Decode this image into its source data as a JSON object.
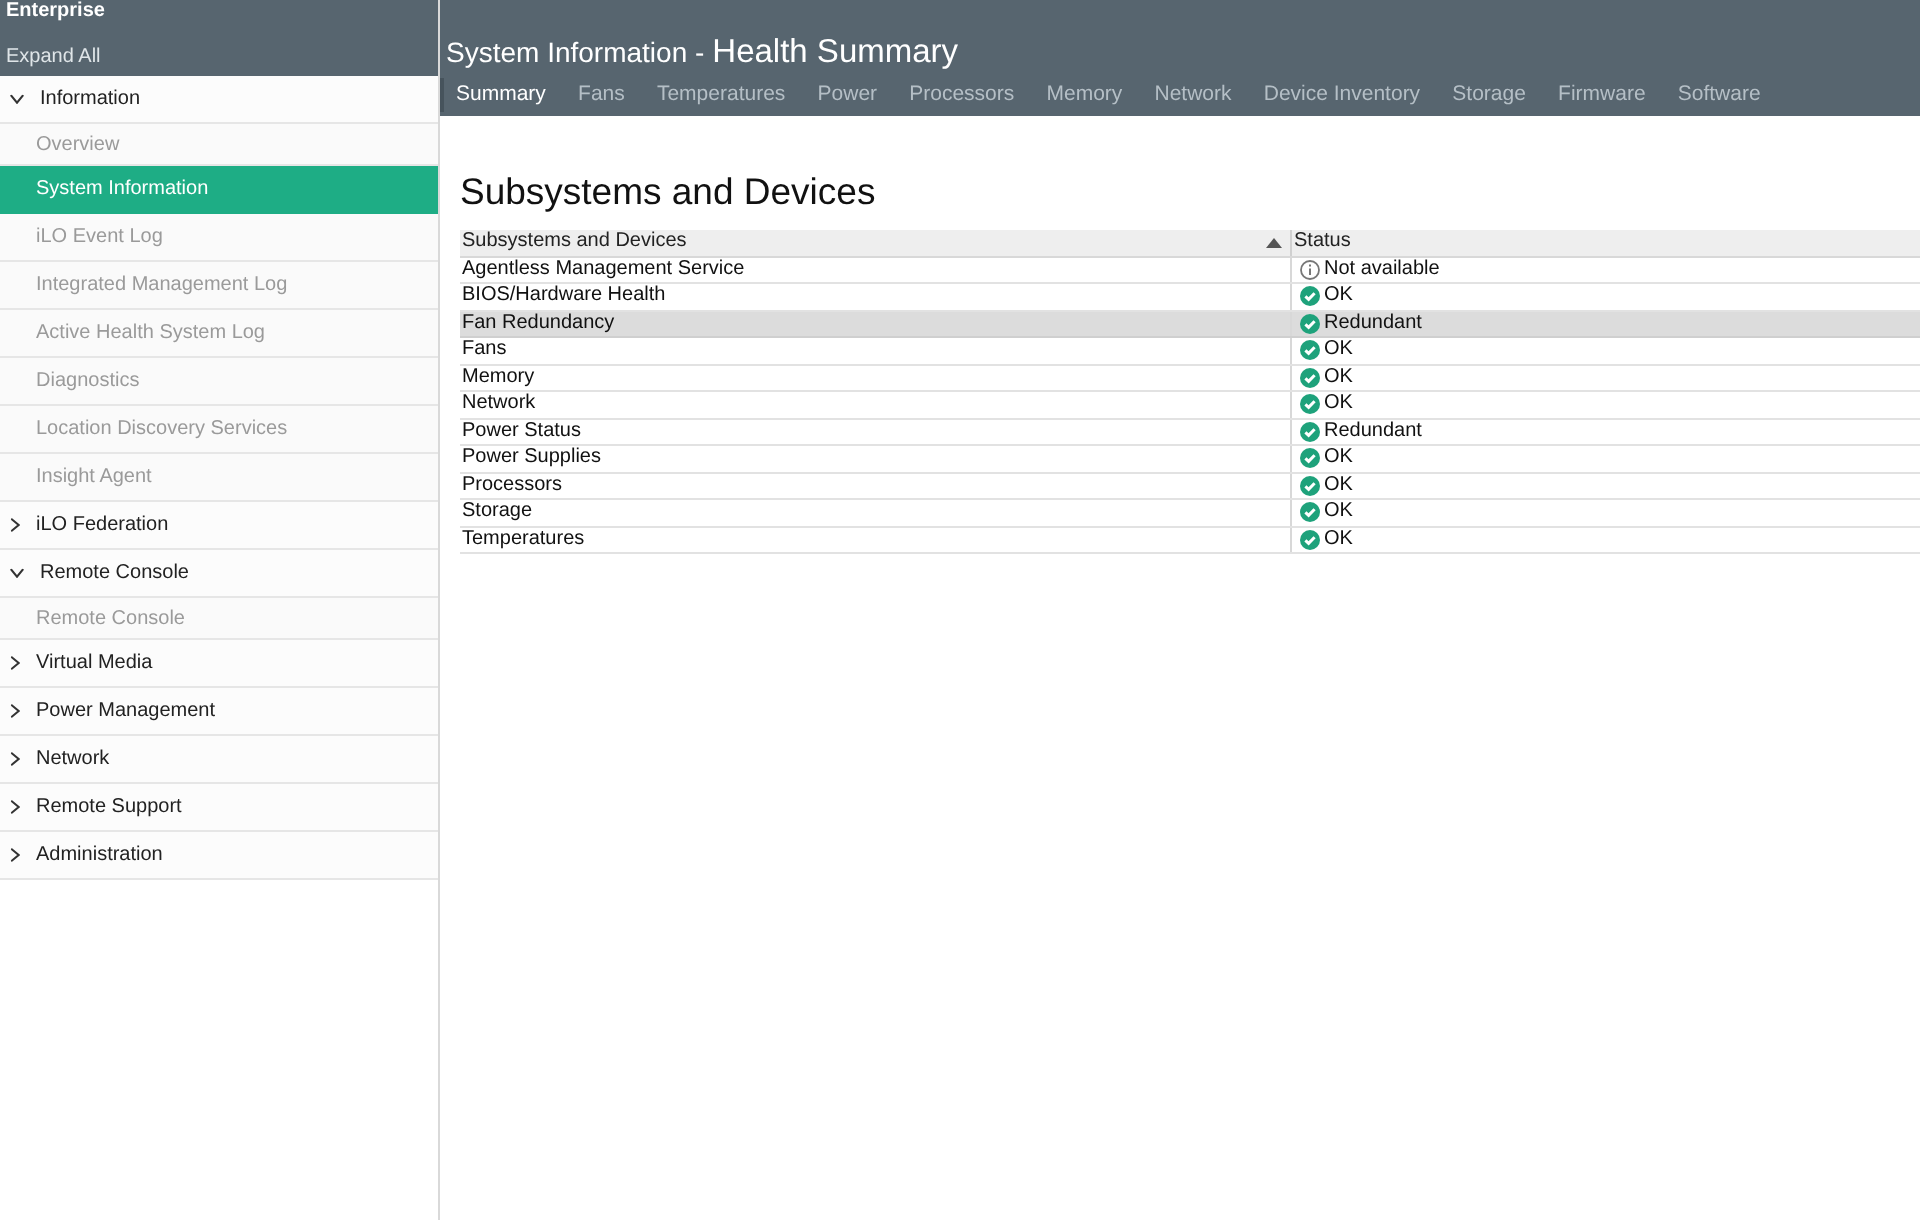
{
  "header": {
    "brand": "Enterprise",
    "expand_all": "Expand All",
    "title": "System Information -",
    "subtitle": "Health Summary"
  },
  "sidebar": {
    "groups": [
      {
        "label": "Information",
        "expanded": true,
        "children": [
          {
            "label": "Overview",
            "selected": false
          },
          {
            "label": "System Information",
            "selected": true
          },
          {
            "label": "iLO Event Log",
            "selected": false
          },
          {
            "label": "Integrated Management Log",
            "selected": false
          },
          {
            "label": "Active Health System Log",
            "selected": false
          },
          {
            "label": "Diagnostics",
            "selected": false
          },
          {
            "label": "Location Discovery Services",
            "selected": false
          },
          {
            "label": "Insight Agent",
            "selected": false
          }
        ]
      },
      {
        "label": "iLO Federation",
        "expanded": false
      },
      {
        "label": "Remote Console",
        "expanded": true,
        "children": [
          {
            "label": "Remote Console",
            "selected": false
          }
        ]
      },
      {
        "label": "Virtual Media",
        "expanded": false
      },
      {
        "label": "Power Management",
        "expanded": false
      },
      {
        "label": "Network",
        "expanded": false
      },
      {
        "label": "Remote Support",
        "expanded": false
      },
      {
        "label": "Administration",
        "expanded": false
      }
    ]
  },
  "tabs": [
    {
      "label": "Summary",
      "selected": true
    },
    {
      "label": "Fans",
      "selected": false
    },
    {
      "label": "Temperatures",
      "selected": false
    },
    {
      "label": "Power",
      "selected": false
    },
    {
      "label": "Processors",
      "selected": false
    },
    {
      "label": "Memory",
      "selected": false
    },
    {
      "label": "Network",
      "selected": false
    },
    {
      "label": "Device Inventory",
      "selected": false
    },
    {
      "label": "Storage",
      "selected": false
    },
    {
      "label": "Firmware",
      "selected": false
    },
    {
      "label": "Software",
      "selected": false
    }
  ],
  "section_title": "Subsystems and Devices",
  "table": {
    "columns": [
      {
        "label": "Subsystems and Devices",
        "sorted": true
      },
      {
        "label": "Status",
        "sorted": false
      }
    ],
    "rows": [
      {
        "name": "Agentless Management Service",
        "status": {
          "kind": "info",
          "text": "Not available"
        },
        "selected": false
      },
      {
        "name": "BIOS/Hardware Health",
        "status": {
          "kind": "ok",
          "text": "OK"
        },
        "selected": false
      },
      {
        "name": "Fan Redundancy",
        "status": {
          "kind": "ok",
          "text": "Redundant"
        },
        "selected": true
      },
      {
        "name": "Fans",
        "status": {
          "kind": "ok",
          "text": "OK"
        },
        "selected": false
      },
      {
        "name": "Memory",
        "status": {
          "kind": "ok",
          "text": "OK"
        },
        "selected": false
      },
      {
        "name": "Network",
        "status": {
          "kind": "ok",
          "text": "OK"
        },
        "selected": false
      },
      {
        "name": "Power Status",
        "status": {
          "kind": "ok",
          "text": "Redundant"
        },
        "selected": false
      },
      {
        "name": "Power Supplies",
        "status": {
          "kind": "ok",
          "text": "OK"
        },
        "selected": false
      },
      {
        "name": "Processors",
        "status": {
          "kind": "ok",
          "text": "OK"
        },
        "selected": false
      },
      {
        "name": "Storage",
        "status": {
          "kind": "ok",
          "text": "OK"
        },
        "selected": false
      },
      {
        "name": "Temperatures",
        "status": {
          "kind": "ok",
          "text": "OK"
        },
        "selected": false
      }
    ]
  }
}
